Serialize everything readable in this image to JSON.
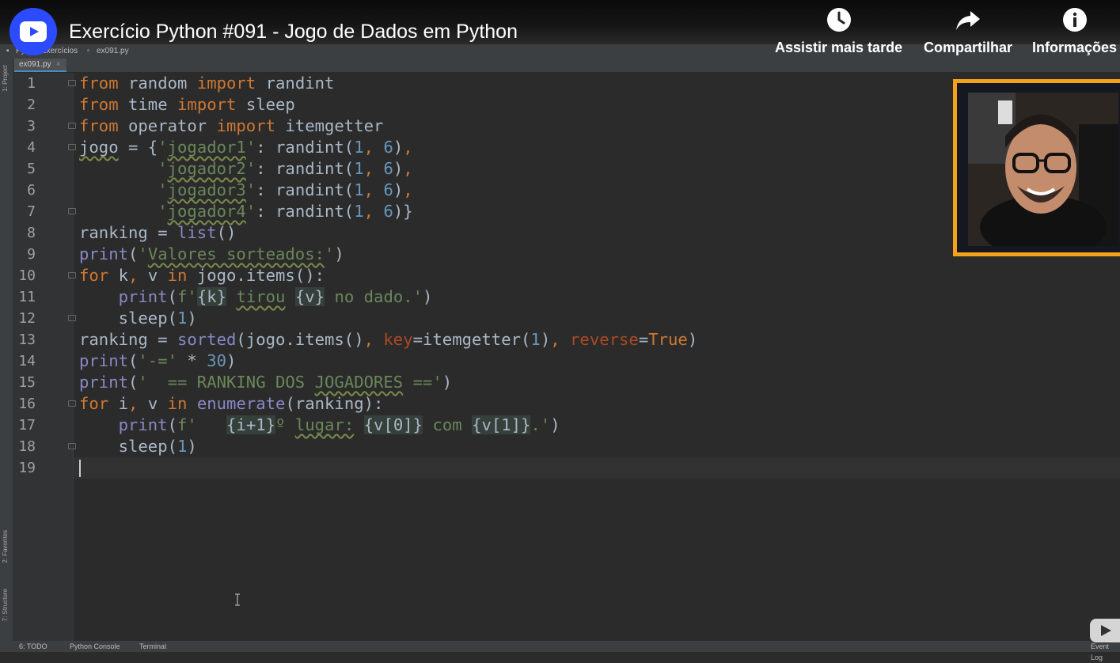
{
  "video": {
    "title": "Exercício Python #091 - Jogo de Dados em Python",
    "actions": [
      {
        "label": "Assistir mais tarde",
        "icon": "clock-icon"
      },
      {
        "label": "Compartilhar",
        "icon": "share-icon"
      },
      {
        "label": "Informações",
        "icon": "info-icon"
      }
    ]
  },
  "ide": {
    "breadcrumb": [
      "Py",
      "Exercícios",
      "ex091.py"
    ],
    "tab": {
      "filename": "ex091.py",
      "close": "×"
    },
    "side_tools": [
      "1: Project",
      "2: Favorites",
      "7: Structure"
    ],
    "bottom_tools": [
      "6: TODO",
      "Python Console",
      "Terminal"
    ],
    "event_log": "Event Log",
    "line_numbers": [
      "1",
      "2",
      "3",
      "4",
      "5",
      "6",
      "7",
      "8",
      "9",
      "10",
      "11",
      "12",
      "13",
      "14",
      "15",
      "16",
      "17",
      "18",
      "19"
    ],
    "code_lines": [
      "from random import randint",
      "from time import sleep",
      "from operator import itemgetter",
      "jogo = {'jogador1': randint(1, 6),",
      "        'jogador2': randint(1, 6),",
      "        'jogador3': randint(1, 6),",
      "        'jogador4': randint(1, 6)}",
      "ranking = list()",
      "print('Valores sorteados:')",
      "for k, v in jogo.items():",
      "    print(f'{k} tirou {v} no dado.')",
      "    sleep(1)",
      "ranking = sorted(jogo.items(), key=itemgetter(1), reverse=True)",
      "print('-=' * 30)",
      "print('  == RANKING DOS JOGADORES ==')",
      "for i, v in enumerate(ranking):",
      "    print(f'   {i+1}º lugar: {v[0]} com {v[1]}.')",
      "    sleep(1)",
      ""
    ]
  },
  "colors": {
    "editor_bg": "#2b2b2b",
    "keyword": "#cc7832",
    "string": "#6a8759",
    "number": "#6897bb",
    "builtin": "#8888c6",
    "webcam_border": "#f5a21b",
    "channel_logo": "#2c4bff"
  }
}
